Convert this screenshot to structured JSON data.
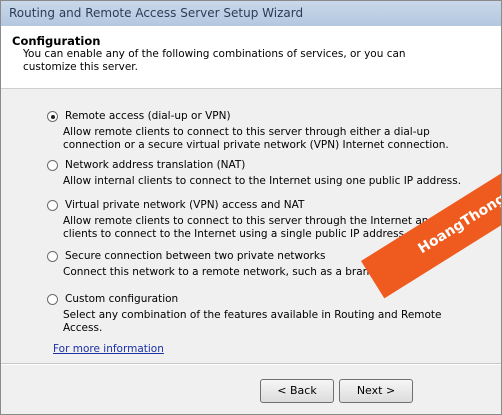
{
  "window": {
    "title": "Routing and Remote Access Server Setup Wizard"
  },
  "header": {
    "title": "Configuration",
    "description": "You can enable any of the following combinations of services, or you can customize this server."
  },
  "options": [
    {
      "label": "Remote access (dial-up or VPN)",
      "selected": true,
      "description": "Allow remote clients to connect to this server through either a dial-up connection or a secure virtual private network (VPN) Internet connection."
    },
    {
      "label": "Network address translation (NAT)",
      "selected": false,
      "description": "Allow internal clients to connect to the Internet using one public IP address."
    },
    {
      "label": "Virtual private network (VPN) access and NAT",
      "selected": false,
      "description": "Allow remote clients to connect to this server through the Internet and local clients to connect to the Internet using a single public IP address."
    },
    {
      "label": "Secure connection between two private networks",
      "selected": false,
      "description": "Connect this network to a remote network, such as a branch office."
    },
    {
      "label": "Custom configuration",
      "selected": false,
      "description": "Select any combination of the features available in Routing and Remote Access."
    }
  ],
  "link": {
    "label": "For more information"
  },
  "buttons": {
    "back": "< Back",
    "next": "Next >"
  },
  "watermark": {
    "text": "HoangThongit.com",
    "color": "#ef5a1e"
  }
}
